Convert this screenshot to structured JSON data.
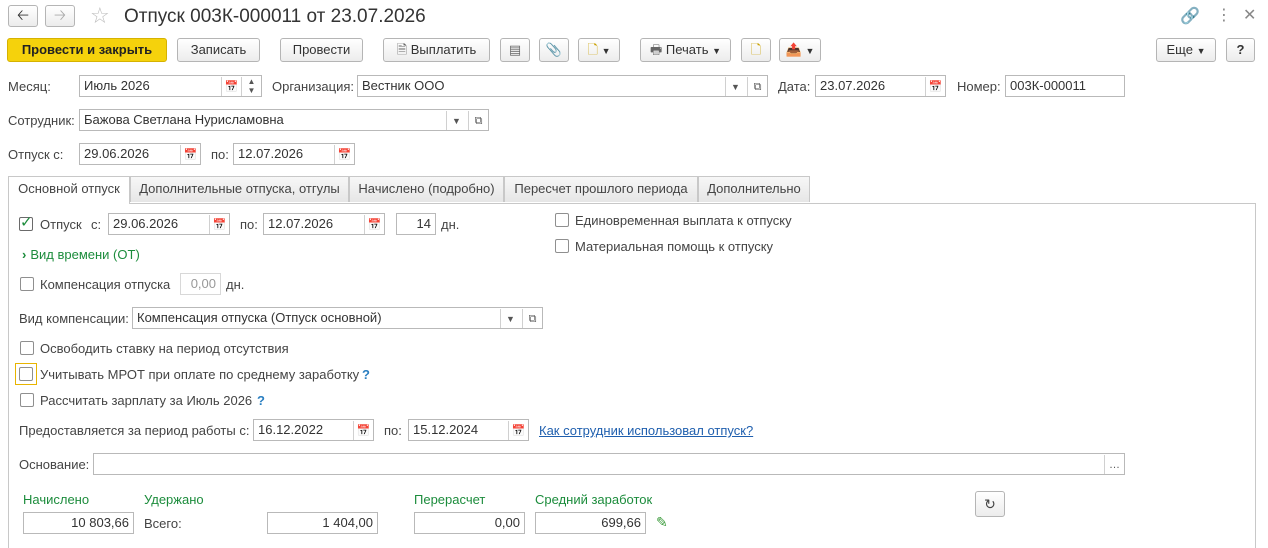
{
  "window": {
    "title": "Отпуск 003К-000011 от 23.07.2026"
  },
  "toolbar": {
    "post_close": "Провести и закрыть",
    "save": "Записать",
    "post": "Провести",
    "pay": "Выплатить",
    "print": "Печать",
    "more": "Еще",
    "help": "?"
  },
  "header": {
    "month_label": "Месяц:",
    "month_value": "Июль 2026",
    "org_label": "Организация:",
    "org_value": "Вестник ООО",
    "date_label": "Дата:",
    "date_value": "23.07.2026",
    "number_label": "Номер:",
    "number_value": "003К-000011",
    "employee_label": "Сотрудник:",
    "employee_value": "Бажова Светлана Нурисламовна",
    "leave_from_label": "Отпуск с:",
    "leave_from_value": "29.06.2026",
    "leave_to_label": "по:",
    "leave_to_value": "12.07.2026"
  },
  "tabs": [
    {
      "label": "Основной отпуск"
    },
    {
      "label": "Дополнительные отпуска, отгулы"
    },
    {
      "label": "Начислено (подробно)"
    },
    {
      "label": "Пересчет прошлого периода"
    },
    {
      "label": "Дополнительно"
    }
  ],
  "main": {
    "leave_check_label": "Отпуск",
    "leave_check_checked": true,
    "from_label": "с:",
    "from_value": "29.06.2026",
    "to_label": "по:",
    "to_value": "12.07.2026",
    "days_value": "14",
    "days_unit": "дн.",
    "lump_sum_label": "Единовременная выплата к отпуску",
    "material_aid_label": "Материальная помощь к отпуску",
    "time_type_link": "Вид времени (ОТ)",
    "compensation_label": "Компенсация отпуска",
    "compensation_days_value": "0,00",
    "compensation_days_unit": "дн.",
    "compensation_type_label": "Вид компенсации:",
    "compensation_type_value": "Компенсация отпуска (Отпуск основной)",
    "free_rate_label": "Освободить ставку на период отсутствия",
    "mrot_label": "Учитывать МРОТ при оплате по среднему заработку",
    "mrot_help": "?",
    "calc_salary_label": "Рассчитать зарплату за Июль 2026",
    "calc_salary_help": "?",
    "period_label": "Предоставляется за период работы с:",
    "period_from_value": "16.12.2022",
    "period_to_label": "по:",
    "period_to_value": "15.12.2024",
    "usage_link": "Как сотрудник использовал отпуск?",
    "basis_label": "Основание:",
    "basis_value": "",
    "accrued_label": "Начислено",
    "accrued_value": "10 803,66",
    "withheld_label": "Удержано",
    "total_label": "Всего:",
    "withheld_value": "1 404,00",
    "recalc_label": "Перерасчет",
    "recalc_value": "0,00",
    "avg_label": "Средний заработок",
    "avg_value": "699,66"
  },
  "colors": {
    "accent_button": "#f5d20c",
    "link": "#1f5fae",
    "green_text": "#1c8c3c"
  }
}
